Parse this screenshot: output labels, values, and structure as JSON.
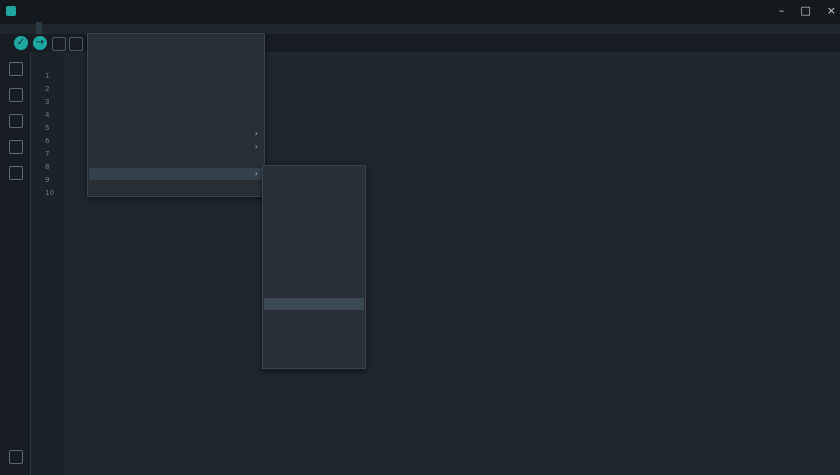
{
  "window": {
    "title": "",
    "controls": [
      "–",
      "□",
      "×"
    ]
  },
  "menubar": [
    "",
    "",
    "",
    ""
  ],
  "active_menu": "",
  "toolbar_right": [
    "",
    ""
  ],
  "editor": {
    "tab": "",
    "line_numbers": [
      "1",
      "2",
      "3",
      "4",
      "5",
      "6",
      "7",
      "8",
      "9",
      "10"
    ]
  },
  "menu1": {
    "items": [
      {
        "label": "",
        "shortcut": ""
      },
      {
        "label": "",
        "shortcut": ""
      },
      {
        "label": "",
        "shortcut": ""
      },
      {
        "label": "",
        "shortcut": ""
      },
      {
        "label": "",
        "shortcut": ""
      },
      {
        "label": "",
        "shortcut": ""
      },
      {
        "label": "",
        "shortcut": ""
      },
      {
        "label": "",
        "shortcut": "",
        "submenu": true
      },
      {
        "label": "",
        "shortcut": "",
        "submenu": true
      },
      {
        "label": "",
        "shortcut": ""
      },
      {
        "label": "",
        "shortcut": "",
        "submenu": true,
        "highlighted": true
      },
      {
        "label": "",
        "shortcut": ""
      }
    ]
  },
  "menu2": {
    "items": [
      "",
      "",
      "",
      "",
      "",
      "",
      "",
      "",
      "",
      "",
      "",
      "",
      "",
      "",
      "",
      ""
    ],
    "highlighted_index": 10
  },
  "status": {
    "text": ""
  }
}
